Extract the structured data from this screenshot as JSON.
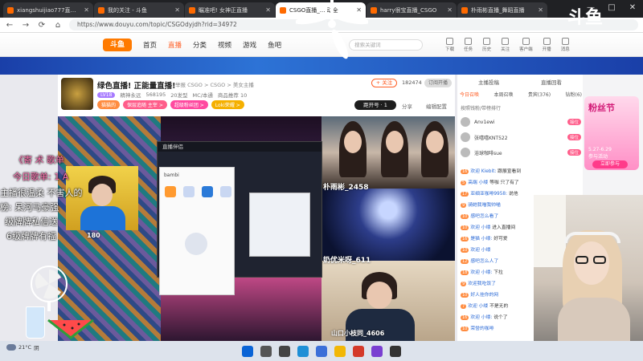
{
  "browser": {
    "tabs": [
      {
        "title": "xiangshuijiao777直播_CSGO",
        "active": false
      },
      {
        "title": "我的关注 - 斗鱼",
        "active": false
      },
      {
        "title": "瞩准吧! 女神正直播",
        "active": false
      },
      {
        "title": "CSGO直播_... 动全",
        "active": true
      },
      {
        "title": "harry很宝直播_CSGO",
        "active": false
      },
      {
        "title": "朴雨彬直播_舞蹈直播",
        "active": false
      }
    ],
    "url": "https://www.douyu.com/topic/CSGOdyjdh?rid=34972",
    "nav_back": "←",
    "nav_forward": "→",
    "nav_refresh": "⟳",
    "nav_home": "⌂",
    "win_min": "—",
    "win_max": "□",
    "win_close": "✕"
  },
  "site": {
    "logo": "斗鱼",
    "nav": [
      "首页",
      "直播",
      "分类",
      "视频",
      "游戏",
      "鱼吧"
    ],
    "active_nav": "直播",
    "search_placeholder": "搜索关键词",
    "header_icons": [
      "下载",
      "任务",
      "历史",
      "关注",
      "客户端",
      "开播",
      "消息"
    ]
  },
  "room": {
    "title": "绿色直播! 正能量直播!",
    "meta": "举报  CSGO > CSGO > 美女主播",
    "level": "LV18",
    "row2": [
      "精神永远",
      "568195",
      "20发型",
      "MC/本通",
      "商品推荐 10"
    ],
    "pills": [
      {
        "label": "猫猫的",
        "color": "#ff8c40"
      },
      {
        "label": "保层追随 主宰 >",
        "color": "#ff5d8a"
      },
      {
        "label": "超级粉丝团 >",
        "color": "#ff4aa0"
      },
      {
        "label": "Loki荣耀 >",
        "color": "#f5b000"
      }
    ],
    "follow": "+ 关注",
    "followers": "182474",
    "subscribe": "订阅开播",
    "countdown": "距开号 · 1",
    "share": "分享",
    "edit": "编辑配置"
  },
  "video": {
    "name_tag_1": "朴雨彬_2458",
    "name_tag_2": "奶优米呀_611",
    "name_tag_3": "山口小枝同_4606",
    "viewer_tag": "180",
    "app_window_title": "直播伴侣",
    "dialog_title": "bambi"
  },
  "overlay": {
    "line1": "《寄 术 歌单",
    "line2": "今日歌单: 1 A",
    "line3": "主播很温柔 不害人的",
    "line4": "榜: 呆河马豪强",
    "line5": "级牌牌私信送",
    "line6": "6级牌牌有福"
  },
  "chat": {
    "top_tabs": [
      "主播投稿",
      "直播回看"
    ],
    "sub_tabs": [
      "今日召唤",
      "本周召唤",
      "贵宾(376)",
      "钻粉(6)"
    ],
    "rank_header": "按照钱粉/带榜排行",
    "ranks": [
      {
        "name": "Anv1ewi",
        "badge": "接位"
      },
      {
        "name": "张嘻嘻KNT522",
        "badge": "接位"
      },
      {
        "name": "浴球咖啡sue",
        "badge": "接位"
      }
    ],
    "messages": [
      {
        "lv": "16",
        "user": "欢迎 Kiebit:",
        "text": "跟展宣看到"
      },
      {
        "lv": "5",
        "user": "高端  小缕",
        "text": "等咖 只了有了"
      },
      {
        "lv": "17",
        "user": "亚细亚咖啡9958:",
        "text": "说他"
      },
      {
        "lv": "9",
        "user": "骑她我喵我帅喵",
        "text": ""
      },
      {
        "lv": "10",
        "user": "感吧怎么看了",
        "text": ""
      },
      {
        "lv": "10",
        "user": "欢迎 小缕",
        "text": "进入直播间"
      },
      {
        "lv": "16",
        "user": "是猫 小缕:",
        "text": "好可爱"
      },
      {
        "lv": "10",
        "user": "欢迎 小缕",
        "text": ""
      },
      {
        "lv": "12",
        "user": "感吧怎么人了",
        "text": ""
      },
      {
        "lv": "18",
        "user": "欢迎 小缕:",
        "text": "下拉"
      },
      {
        "lv": "9",
        "user": "欢迎我吃饭了",
        "text": ""
      },
      {
        "lv": "10",
        "user": "好人挂你的网",
        "text": ""
      },
      {
        "lv": "7",
        "user": "欢迎 小缕",
        "text": "不是无的"
      },
      {
        "lv": "16",
        "user": "欢迎 小缕:",
        "text": "说个了"
      },
      {
        "lv": "10",
        "user": "荣誉的咖啡",
        "text": ""
      }
    ]
  },
  "promo": {
    "title": "粉丝节",
    "subtitle": "5.27-6.29",
    "cta": "参与活动",
    "btn": "立即参与"
  },
  "watermark": "斗鱼",
  "taskbar": {
    "weather_temp": "21°C",
    "weather_desc": "阴",
    "icons": [
      {
        "name": "windows-start-icon",
        "color": "#0a64d6"
      },
      {
        "name": "search-icon",
        "color": "#555555"
      },
      {
        "name": "task-view-icon",
        "color": "#444444"
      },
      {
        "name": "edge-icon",
        "color": "#1e8fd6"
      },
      {
        "name": "store-icon",
        "color": "#3b6fd8"
      },
      {
        "name": "explorer-icon",
        "color": "#f2b705"
      },
      {
        "name": "app-icon-red",
        "color": "#d43a2a"
      },
      {
        "name": "app-icon-purple",
        "color": "#7a3fd1"
      },
      {
        "name": "obs-icon",
        "color": "#333333"
      }
    ]
  }
}
